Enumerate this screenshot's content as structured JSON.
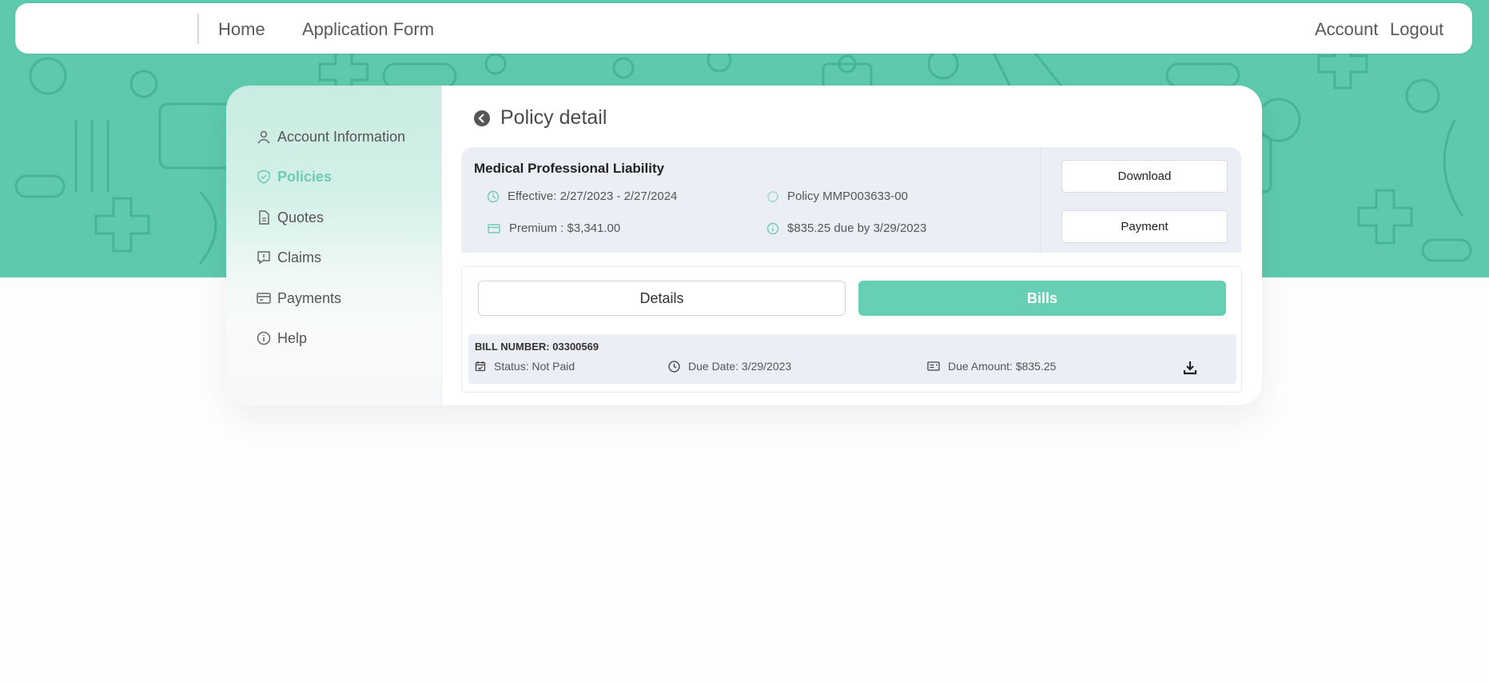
{
  "nav": {
    "home": "Home",
    "application_form": "Application Form",
    "account": "Account",
    "logout": "Logout"
  },
  "sidebar": {
    "items": [
      {
        "label": "Account Information",
        "icon": "user-icon"
      },
      {
        "label": "Policies",
        "icon": "shield-icon",
        "active": true
      },
      {
        "label": "Quotes",
        "icon": "document-icon"
      },
      {
        "label": "Claims",
        "icon": "message-alert-icon"
      },
      {
        "label": "Payments",
        "icon": "card-icon"
      },
      {
        "label": "Help",
        "icon": "info-icon"
      }
    ]
  },
  "page": {
    "title": "Policy detail"
  },
  "policy": {
    "name": "Medical Professional Liability",
    "effective": "Effective: 2/27/2023 - 2/27/2024",
    "policy_number": "Policy MMP003633-00",
    "premium": "Premium : $3,341.00",
    "due": "$835.25 due by 3/29/2023",
    "download_label": "Download",
    "payment_label": "Payment"
  },
  "tabs": {
    "details": "Details",
    "bills": "Bills",
    "active": "Bills"
  },
  "bills": [
    {
      "number": "BILL NUMBER: 03300569",
      "status": "Status: Not Paid",
      "due_date": "Due Date: 3/29/2023",
      "due_amount": "Due Amount: $835.25"
    }
  ],
  "colors": {
    "accent": "#66cfb4",
    "hero_bg": "#5ec9ad",
    "panel_bg": "#eceef6"
  }
}
